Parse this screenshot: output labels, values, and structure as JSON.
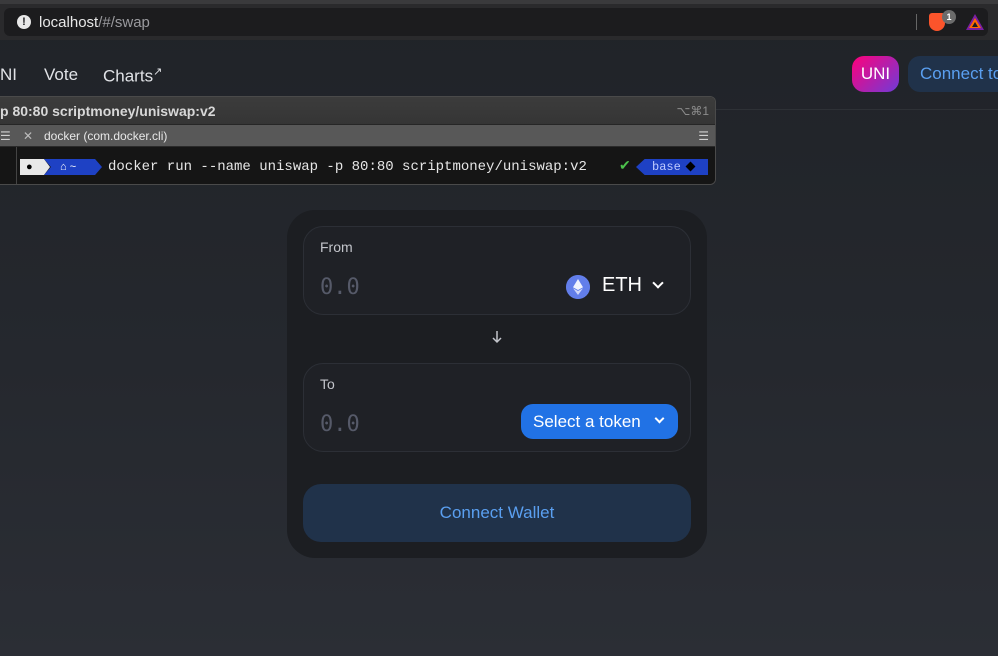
{
  "browser": {
    "url_host": "localhost",
    "url_path": "/#/swap",
    "warning_icon": "exclamation-circle-icon",
    "extension_badge": "1"
  },
  "header": {
    "nav": [
      "NI",
      "Vote",
      "Charts"
    ],
    "charts_external_mark": "↗",
    "uni_badge": "UNI",
    "connect_label": "Connect to"
  },
  "terminal": {
    "title": "p 80:80 scriptmoney/uniswap:v2",
    "shortcut": "⌥⌘1",
    "tab_label": "docker (com.docker.cli)",
    "prompt_home": "~",
    "command": "docker run --name uniswap -p 80:80 scriptmoney/uniswap:v2",
    "status_check": "✔",
    "env": "base"
  },
  "swap": {
    "from_label": "From",
    "from_placeholder": "0.0",
    "from_token": "ETH",
    "to_label": "To",
    "to_placeholder": "0.0",
    "select_token_label": "Select a token",
    "connect_wallet_label": "Connect Wallet"
  },
  "colors": {
    "accent_blue": "#2172e5",
    "connect_text": "#5a9ff0",
    "uni_pink": "#ff007a",
    "eth_purple": "#627eea"
  }
}
